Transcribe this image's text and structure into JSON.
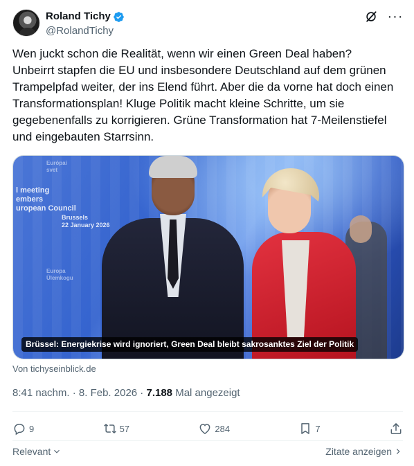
{
  "author": {
    "display_name": "Roland Tichy",
    "handle": "@RolandTichy",
    "verified_color": "#1d9bf0"
  },
  "tweet": {
    "text": "Wen juckt schon die Realität, wenn wir einen Green Deal haben?\nUnbeirrt stapfen die EU und insbesondere Deutschland auf dem grünen Trampelpfad weiter, der ins Elend führt. Aber die da vorne hat doch einen Transformationsplan! Kluge Politik macht kleine Schritte, um sie gegebenenfalls zu korrigieren. Grüne Transformation hat 7-Meilenstiefel und eingebauten Starrsinn."
  },
  "media": {
    "caption": "Brüssel: Energiekrise wird ignoriert, Green Deal bleibt sakrosanktes Ziel der Politik",
    "source_label": "Von tichyseinblick.de"
  },
  "meta": {
    "time": "8:41 nachm.",
    "separator": " · ",
    "date": "8. Feb. 2026",
    "views_count": "7.188",
    "views_label": "Mal angezeigt"
  },
  "actions": {
    "replies": "9",
    "reposts": "57",
    "likes": "284",
    "bookmarks": "7"
  },
  "footer": {
    "sort_label": "Relevant",
    "quotes_label": "Zitate anzeigen"
  },
  "icons": {
    "grok": "grok-icon",
    "more": "more-icon",
    "reply": "reply-icon",
    "repost": "repost-icon",
    "like": "heart-icon",
    "bookmark": "bookmark-icon",
    "share": "share-icon"
  }
}
